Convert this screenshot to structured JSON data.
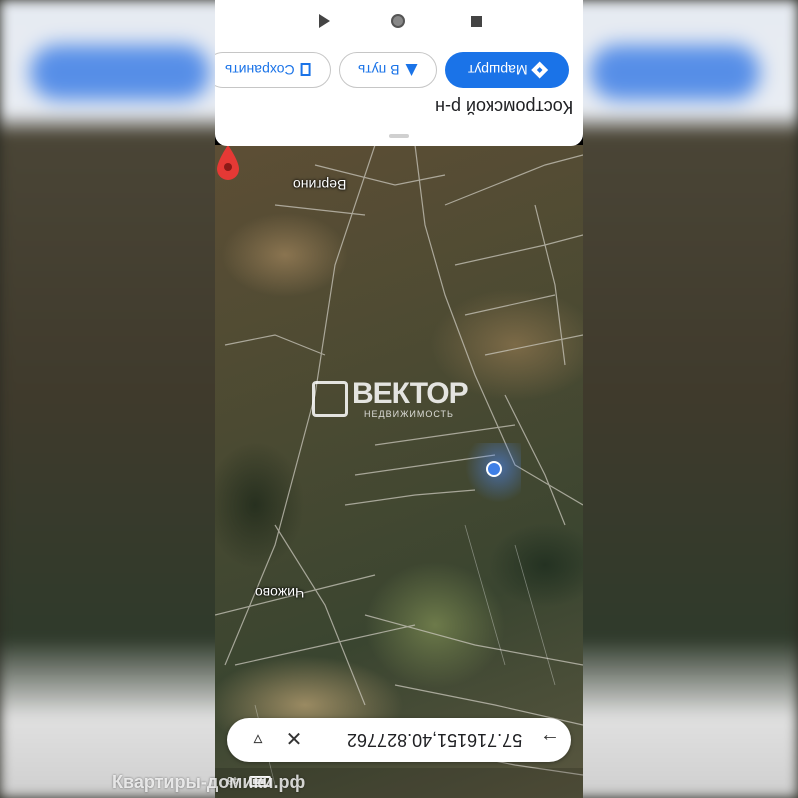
{
  "nav": {
    "play_icon": "play-icon",
    "home_icon": "home-circle-icon",
    "stop_icon": "stop-square-icon"
  },
  "chips": {
    "route_label": "Маршрут",
    "go_label": "В путь",
    "save_label": "Сохранить"
  },
  "place": {
    "name": "Костромской р-н"
  },
  "map": {
    "labels": [
      "Вергино",
      "Чижово"
    ],
    "pin_color": "#e53935",
    "location_color": "#3f7fe6",
    "watermark_title": "ВЕКТОР",
    "watermark_sub": "НЕДВИЖИМОСТЬ"
  },
  "search": {
    "query": "57.716151,40.827762"
  },
  "status": {
    "battery_text": "48"
  },
  "site_watermark": "Квартиры-домики.рф",
  "colors": {
    "accent": "#1a73e8"
  }
}
